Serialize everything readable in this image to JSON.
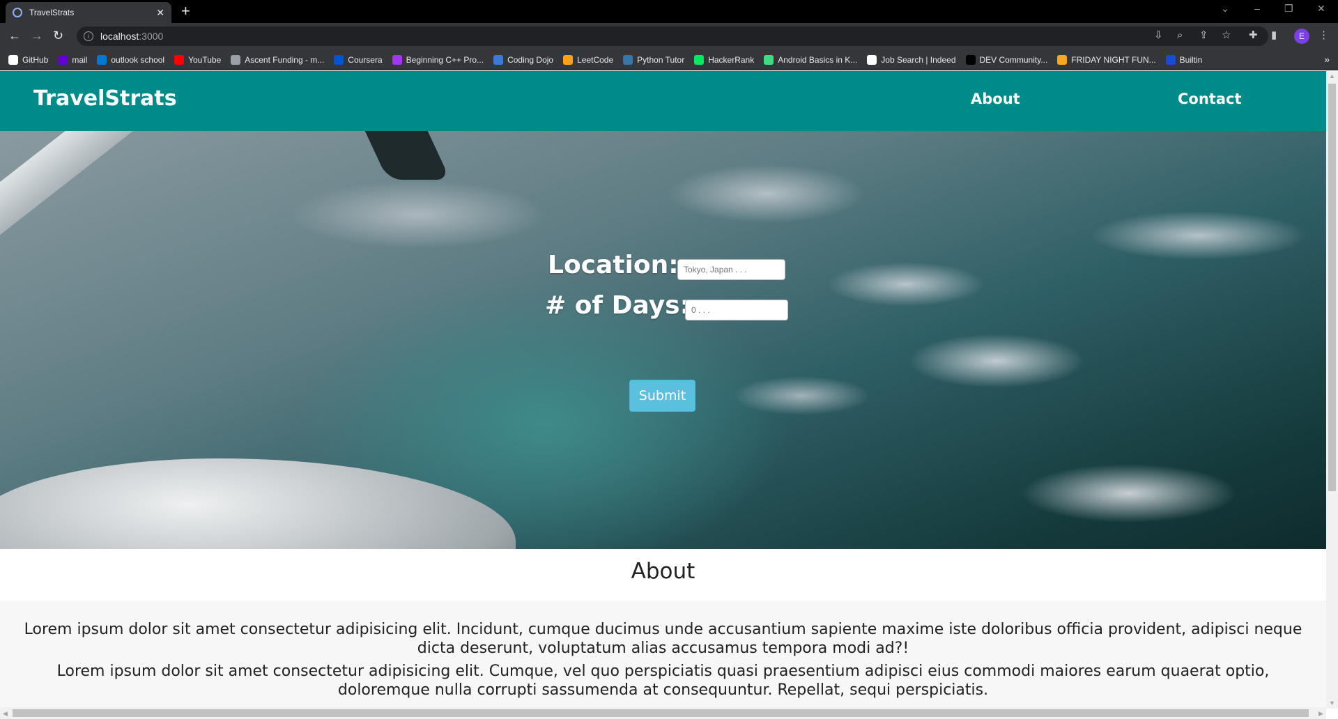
{
  "browser": {
    "tab_title": "TravelStrats",
    "url_host": "localhost",
    "url_port": ":3000",
    "profile_initial": "E",
    "bookmarks": [
      {
        "label": "GitHub",
        "color": "#ffffff"
      },
      {
        "label": "mail",
        "color": "#6001d2"
      },
      {
        "label": "outlook school",
        "color": "#0078d4"
      },
      {
        "label": "YouTube",
        "color": "#ff0000"
      },
      {
        "label": "Ascent Funding - m...",
        "color": "#9aa0a6"
      },
      {
        "label": "Coursera",
        "color": "#0056d2"
      },
      {
        "label": "Beginning C++ Pro...",
        "color": "#a435f0"
      },
      {
        "label": "Coding Dojo",
        "color": "#3a7bd5"
      },
      {
        "label": "LeetCode",
        "color": "#ffa116"
      },
      {
        "label": "Python Tutor",
        "color": "#3776ab"
      },
      {
        "label": "HackerRank",
        "color": "#00ea64"
      },
      {
        "label": "Android Basics in K...",
        "color": "#3ddc84"
      },
      {
        "label": "Job Search | Indeed",
        "color": "#ffffff"
      },
      {
        "label": "DEV Community...",
        "color": "#000000"
      },
      {
        "label": "FRIDAY NIGHT FUN...",
        "color": "#f5a623"
      },
      {
        "label": "Builtin",
        "color": "#1a4bd6"
      }
    ]
  },
  "navbar": {
    "brand": "TravelStrats",
    "links": [
      "About",
      "Contact"
    ],
    "bg_color": "#008b8b"
  },
  "form": {
    "location_label": "Location:",
    "location_placeholder": "Tokyo, Japan . . .",
    "days_label": "# of Days:",
    "days_placeholder": "0 . . .",
    "submit_label": "Submit"
  },
  "about": {
    "title": "About",
    "paragraphs": [
      "Lorem ipsum dolor sit amet consectetur adipisicing elit. Incidunt, cumque ducimus unde accusantium sapiente maxime iste doloribus officia provident, adipisci neque dicta deserunt, voluptatum alias accusamus tempora modi ad?!",
      "Lorem ipsum dolor sit amet consectetur adipisicing elit. Cumque, vel quo perspiciatis quasi praesentium adipisci eius commodi maiores earum quaerat optio, doloremque nulla corrupti sassumenda at consequuntur. Repellat, sequi perspiciatis."
    ]
  }
}
